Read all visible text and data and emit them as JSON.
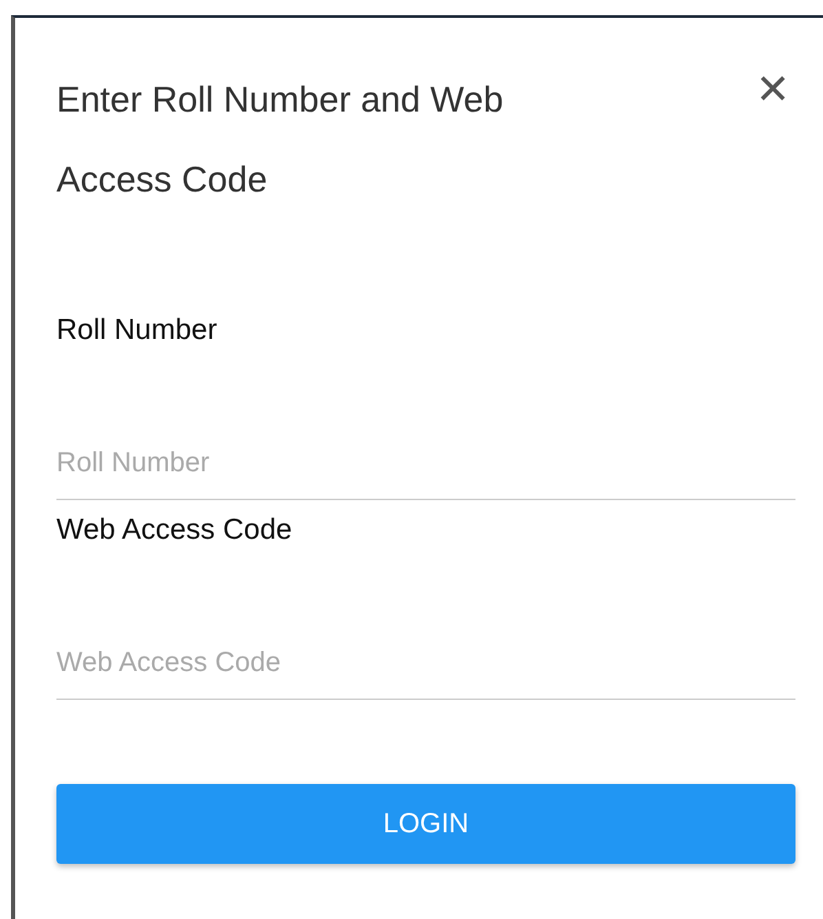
{
  "dialog": {
    "title": "Enter Roll Number and Web Access Code",
    "close": "✕"
  },
  "fields": [
    {
      "label": "Roll Number",
      "placeholder": "Roll Number"
    },
    {
      "label": "Web Access Code",
      "placeholder": "Web Access Code"
    }
  ],
  "button": "LOGIN"
}
